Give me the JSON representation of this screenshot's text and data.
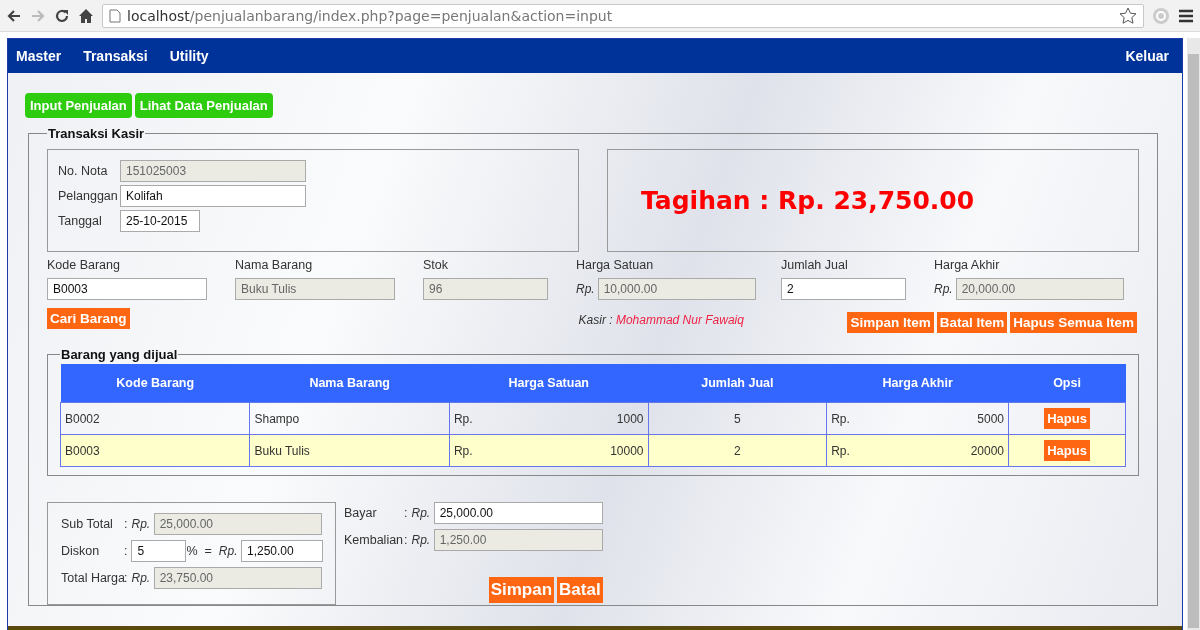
{
  "browser": {
    "url_host": "localhost",
    "url_path": "/penjualanbarang/index.php?page=penjualan&action=input",
    "forward_disabled": true
  },
  "nav": {
    "items": [
      "Master",
      "Transaksi",
      "Utility"
    ],
    "logout": "Keluar"
  },
  "tabs": [
    {
      "label": "Input Penjualan"
    },
    {
      "label": "Lihat Data Penjualan"
    }
  ],
  "transaksi": {
    "legend": "Transaksi Kasir",
    "header_fields": [
      {
        "label": "No. Nota",
        "value": "151025003",
        "readonly": true
      },
      {
        "label": "Pelanggan",
        "value": "Kolifah",
        "readonly": false
      },
      {
        "label": "Tanggal",
        "value": "25-10-2015",
        "readonly": false
      }
    ],
    "tagihan": "Tagihan : Rp. 23,750.00",
    "item_fields": [
      {
        "label": "Kode Barang",
        "value": "B0003",
        "readonly": false
      },
      {
        "label": "Nama Barang",
        "value": "Buku Tulis",
        "readonly": true
      },
      {
        "label": "Stok",
        "value": "96",
        "readonly": true
      },
      {
        "label": "Harga Satuan",
        "prefix": "Rp.",
        "value": "10,000.00",
        "readonly": true
      },
      {
        "label": "Jumlah Jual",
        "value": "2",
        "readonly": false
      },
      {
        "label": "Harga Akhir",
        "prefix": "Rp.",
        "value": "20,000.00",
        "readonly": true
      }
    ],
    "search_button": "Cari Barang",
    "cashier_label": "Kasir :",
    "cashier_name": "Mohammad Nur Fawaiq",
    "item_buttons": [
      "Simpan Item",
      "Batal Item",
      "Hapus Semua Item"
    ]
  },
  "sold_items": {
    "legend": "Barang yang dijual",
    "columns": [
      "Kode Barang",
      "Nama Barang",
      "Harga Satuan",
      "Jumlah Jual",
      "Harga Akhir",
      "Opsi"
    ],
    "rows": [
      {
        "kode": "B0002",
        "nama": "Shampo",
        "harga_prefix": "Rp.",
        "harga": "1000",
        "jumlah": "5",
        "akhir_prefix": "Rp.",
        "akhir": "5000",
        "action": "Hapus",
        "selected": false
      },
      {
        "kode": "B0003",
        "nama": "Buku Tulis",
        "harga_prefix": "Rp.",
        "harga": "10000",
        "jumlah": "2",
        "akhir_prefix": "Rp.",
        "akhir": "20000",
        "action": "Hapus",
        "selected": true
      }
    ]
  },
  "summary": [
    {
      "kind": "amount",
      "label": "Sub Total",
      "colon": ":",
      "prefix": "Rp.",
      "value": "25,000.00",
      "readonly": true
    },
    {
      "kind": "discount",
      "label": "Diskon",
      "colon": ":",
      "percent": "5",
      "percent_sign": "%",
      "equals": "=",
      "prefix": "Rp.",
      "value": "1,250.00",
      "readonly": false
    },
    {
      "kind": "amount",
      "label": "Total Harga",
      "colon": ":",
      "prefix": "Rp.",
      "value": "23,750.00",
      "readonly": true
    }
  ],
  "payment": [
    {
      "label": "Bayar",
      "colon": ":",
      "prefix": "Rp.",
      "value": "25,000.00",
      "readonly": false
    },
    {
      "label": "Kembalian",
      "colon": ":",
      "prefix": "Rp.",
      "value": "1,250.00",
      "readonly": true
    }
  ],
  "final_buttons": [
    "Simpan",
    "Batal"
  ]
}
